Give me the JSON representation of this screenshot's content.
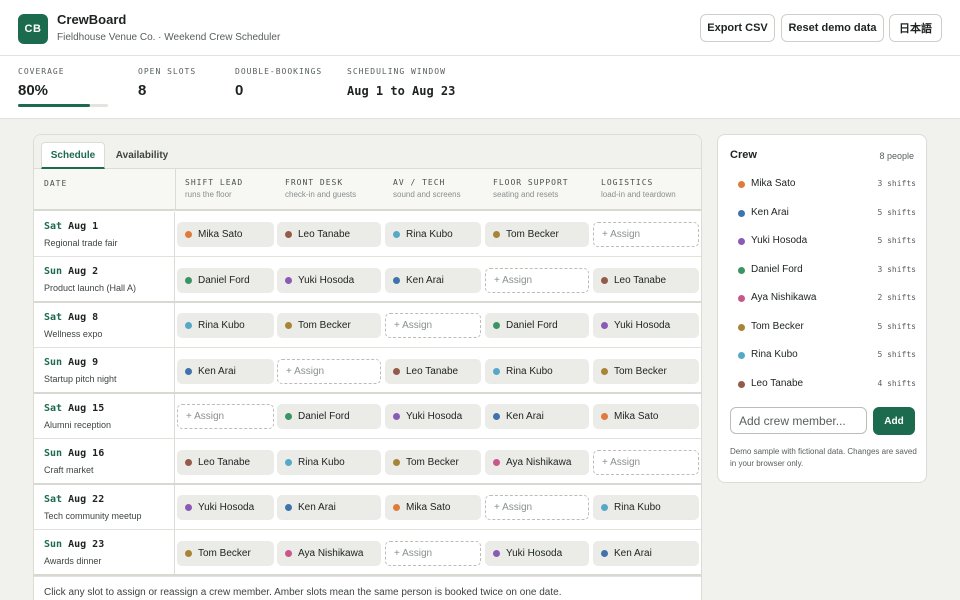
{
  "app": {
    "logo": "CB",
    "name": "CrewBoard",
    "subtitle": "Fieldhouse Venue Co. · Weekend Crew Scheduler"
  },
  "header_buttons": {
    "export": "Export CSV",
    "reset": "Reset demo data",
    "language": "日本語"
  },
  "stats": {
    "coverage_label": "COVERAGE",
    "coverage_value": "80%",
    "coverage_fraction": 0.8,
    "open_label": "OPEN SLOTS",
    "open_value": "8",
    "double_label": "DOUBLE-BOOKINGS",
    "double_value": "0",
    "window_label": "SCHEDULING WINDOW",
    "window_value": "Aug 1 to Aug 23"
  },
  "tabs": [
    "Schedule",
    "Availability"
  ],
  "columns": {
    "date": "DATE",
    "roles": [
      {
        "title": "SHIFT LEAD",
        "sub": "runs the floor"
      },
      {
        "title": "FRONT DESK",
        "sub": "check-in and guests"
      },
      {
        "title": "AV / TECH",
        "sub": "sound and screens"
      },
      {
        "title": "FLOOR SUPPORT",
        "sub": "seating and resets"
      },
      {
        "title": "LOGISTICS",
        "sub": "load-in and teardown"
      }
    ]
  },
  "assign_label": "+ Assign",
  "colors": {
    "Mika Sato": "#e07b3b",
    "Ken Arai": "#3f73ad",
    "Yuki Hosoda": "#8a5bb6",
    "Daniel Ford": "#3a9563",
    "Aya Nishikawa": "#c9578a",
    "Tom Becker": "#a88436",
    "Rina Kubo": "#56a8c9",
    "Leo Tanabe": "#935b48"
  },
  "rows": [
    {
      "dow": "Sat",
      "date": "Aug 1",
      "event": "Regional trade fair",
      "slots": [
        "Mika Sato",
        "Leo Tanabe",
        "Rina Kubo",
        "Tom Becker",
        ""
      ]
    },
    {
      "dow": "Sun",
      "date": "Aug 2",
      "event": "Product launch (Hall A)",
      "slots": [
        "Daniel Ford",
        "Yuki Hosoda",
        "Ken Arai",
        "",
        "Leo Tanabe"
      ]
    },
    {
      "dow": "Sat",
      "date": "Aug 8",
      "event": "Wellness expo",
      "slots": [
        "Rina Kubo",
        "Tom Becker",
        "",
        "Daniel Ford",
        "Yuki Hosoda"
      ]
    },
    {
      "dow": "Sun",
      "date": "Aug 9",
      "event": "Startup pitch night",
      "slots": [
        "Ken Arai",
        "",
        "Leo Tanabe",
        "Rina Kubo",
        "Tom Becker"
      ]
    },
    {
      "dow": "Sat",
      "date": "Aug 15",
      "event": "Alumni reception",
      "slots": [
        "",
        "Daniel Ford",
        "Yuki Hosoda",
        "Ken Arai",
        "Mika Sato"
      ]
    },
    {
      "dow": "Sun",
      "date": "Aug 16",
      "event": "Craft market",
      "slots": [
        "Leo Tanabe",
        "Rina Kubo",
        "Tom Becker",
        "Aya Nishikawa",
        ""
      ]
    },
    {
      "dow": "Sat",
      "date": "Aug 22",
      "event": "Tech community meetup",
      "slots": [
        "Yuki Hosoda",
        "Ken Arai",
        "Mika Sato",
        "",
        "Rina Kubo"
      ]
    },
    {
      "dow": "Sun",
      "date": "Aug 23",
      "event": "Awards dinner",
      "slots": [
        "Tom Becker",
        "Aya Nishikawa",
        "",
        "Yuki Hosoda",
        "Ken Arai"
      ]
    }
  ],
  "footer_note": "Click any slot to assign or reassign a crew member. Amber slots mean the same person is booked twice on one date.",
  "crew": {
    "title": "Crew",
    "count": "8 people",
    "members": [
      {
        "name": "Mika Sato",
        "shifts": "3 shifts"
      },
      {
        "name": "Ken Arai",
        "shifts": "5 shifts"
      },
      {
        "name": "Yuki Hosoda",
        "shifts": "5 shifts"
      },
      {
        "name": "Daniel Ford",
        "shifts": "3 shifts"
      },
      {
        "name": "Aya Nishikawa",
        "shifts": "2 shifts"
      },
      {
        "name": "Tom Becker",
        "shifts": "5 shifts"
      },
      {
        "name": "Rina Kubo",
        "shifts": "5 shifts"
      },
      {
        "name": "Leo Tanabe",
        "shifts": "4 shifts"
      }
    ],
    "input_placeholder": "Add crew member...",
    "add_label": "Add",
    "note": "Demo sample with fictional data. Changes are saved in your browser only."
  }
}
